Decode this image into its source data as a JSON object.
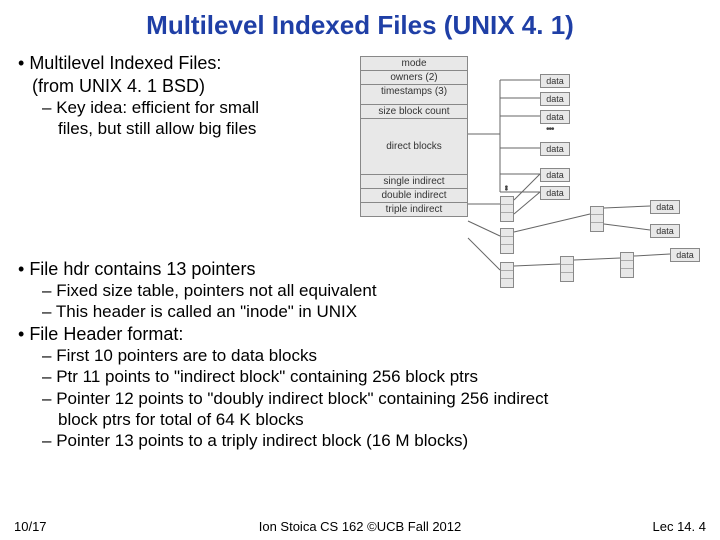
{
  "title": "Multilevel Indexed Files (UNIX 4. 1)",
  "top": {
    "l1": "Multilevel Indexed Files:",
    "l2": "(from UNIX 4. 1 BSD)",
    "s1": "Key idea: efficient for small",
    "s2": "files, but still allow big files"
  },
  "mid": {
    "p1": "File hdr contains 13 pointers",
    "p1a": "Fixed size table, pointers not all equivalent",
    "p1b": "This header is called an \"inode\" in UNIX",
    "p2": "File Header format:",
    "p2a": "First 10 pointers are to data blocks",
    "p2b": "Ptr 11 points to \"indirect block\" containing 256 block ptrs",
    "p2c": "Pointer 12 points to \"doubly indirect block\" containing 256 indirect",
    "p2c2": "block ptrs for total of 64 K blocks",
    "p2d": "Pointer 13 points to a triply indirect block (16 M blocks)"
  },
  "footer": {
    "left": "10/17",
    "center": "Ion Stoica CS 162 ©UCB Fall 2012",
    "right": "Lec 14. 4"
  },
  "diagram": {
    "inode": {
      "mode": "mode",
      "owners": "owners (2)",
      "timestamps": "timestamps (3)",
      "size": "size block count",
      "direct": "direct blocks",
      "single": "single indirect",
      "double": "double indirect",
      "triple": "triple indirect"
    },
    "data": "data"
  }
}
